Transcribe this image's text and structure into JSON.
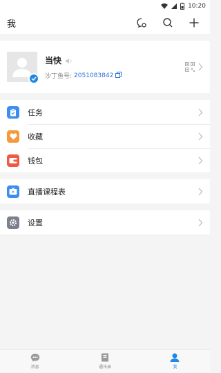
{
  "status_bar": {
    "time": "10:20"
  },
  "header": {
    "title": "我"
  },
  "profile": {
    "name": "当快",
    "id_label": "沙丁鱼号:",
    "id_value": "2051083842"
  },
  "menu": {
    "group1": [
      {
        "key": "tasks",
        "label": "任务",
        "color": "#3b8ef0"
      },
      {
        "key": "favorites",
        "label": "收藏",
        "color": "#f59a3a"
      },
      {
        "key": "wallet",
        "label": "钱包",
        "color": "#ef5a43"
      }
    ],
    "group2": [
      {
        "key": "live-schedule",
        "label": "直播课程表",
        "color": "#3b8ef0"
      }
    ],
    "group3": [
      {
        "key": "settings",
        "label": "设置",
        "color": "#7c7f8c"
      }
    ]
  },
  "tabbar": {
    "tabs": [
      {
        "label": "消息"
      },
      {
        "label": "通讯录"
      },
      {
        "label": "我"
      }
    ],
    "active_color": "#1e88e5"
  }
}
